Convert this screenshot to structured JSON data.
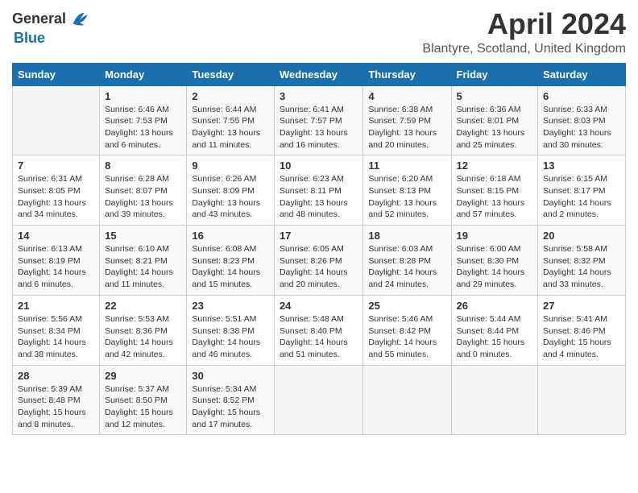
{
  "header": {
    "logo_general": "General",
    "logo_blue": "Blue",
    "month_year": "April 2024",
    "location": "Blantyre, Scotland, United Kingdom"
  },
  "days_of_week": [
    "Sunday",
    "Monday",
    "Tuesday",
    "Wednesday",
    "Thursday",
    "Friday",
    "Saturday"
  ],
  "weeks": [
    [
      {
        "day": "",
        "sunrise": "",
        "sunset": "",
        "daylight": ""
      },
      {
        "day": "1",
        "sunrise": "Sunrise: 6:46 AM",
        "sunset": "Sunset: 7:53 PM",
        "daylight": "Daylight: 13 hours and 6 minutes."
      },
      {
        "day": "2",
        "sunrise": "Sunrise: 6:44 AM",
        "sunset": "Sunset: 7:55 PM",
        "daylight": "Daylight: 13 hours and 11 minutes."
      },
      {
        "day": "3",
        "sunrise": "Sunrise: 6:41 AM",
        "sunset": "Sunset: 7:57 PM",
        "daylight": "Daylight: 13 hours and 16 minutes."
      },
      {
        "day": "4",
        "sunrise": "Sunrise: 6:38 AM",
        "sunset": "Sunset: 7:59 PM",
        "daylight": "Daylight: 13 hours and 20 minutes."
      },
      {
        "day": "5",
        "sunrise": "Sunrise: 6:36 AM",
        "sunset": "Sunset: 8:01 PM",
        "daylight": "Daylight: 13 hours and 25 minutes."
      },
      {
        "day": "6",
        "sunrise": "Sunrise: 6:33 AM",
        "sunset": "Sunset: 8:03 PM",
        "daylight": "Daylight: 13 hours and 30 minutes."
      }
    ],
    [
      {
        "day": "7",
        "sunrise": "Sunrise: 6:31 AM",
        "sunset": "Sunset: 8:05 PM",
        "daylight": "Daylight: 13 hours and 34 minutes."
      },
      {
        "day": "8",
        "sunrise": "Sunrise: 6:28 AM",
        "sunset": "Sunset: 8:07 PM",
        "daylight": "Daylight: 13 hours and 39 minutes."
      },
      {
        "day": "9",
        "sunrise": "Sunrise: 6:26 AM",
        "sunset": "Sunset: 8:09 PM",
        "daylight": "Daylight: 13 hours and 43 minutes."
      },
      {
        "day": "10",
        "sunrise": "Sunrise: 6:23 AM",
        "sunset": "Sunset: 8:11 PM",
        "daylight": "Daylight: 13 hours and 48 minutes."
      },
      {
        "day": "11",
        "sunrise": "Sunrise: 6:20 AM",
        "sunset": "Sunset: 8:13 PM",
        "daylight": "Daylight: 13 hours and 52 minutes."
      },
      {
        "day": "12",
        "sunrise": "Sunrise: 6:18 AM",
        "sunset": "Sunset: 8:15 PM",
        "daylight": "Daylight: 13 hours and 57 minutes."
      },
      {
        "day": "13",
        "sunrise": "Sunrise: 6:15 AM",
        "sunset": "Sunset: 8:17 PM",
        "daylight": "Daylight: 14 hours and 2 minutes."
      }
    ],
    [
      {
        "day": "14",
        "sunrise": "Sunrise: 6:13 AM",
        "sunset": "Sunset: 8:19 PM",
        "daylight": "Daylight: 14 hours and 6 minutes."
      },
      {
        "day": "15",
        "sunrise": "Sunrise: 6:10 AM",
        "sunset": "Sunset: 8:21 PM",
        "daylight": "Daylight: 14 hours and 11 minutes."
      },
      {
        "day": "16",
        "sunrise": "Sunrise: 6:08 AM",
        "sunset": "Sunset: 8:23 PM",
        "daylight": "Daylight: 14 hours and 15 minutes."
      },
      {
        "day": "17",
        "sunrise": "Sunrise: 6:05 AM",
        "sunset": "Sunset: 8:26 PM",
        "daylight": "Daylight: 14 hours and 20 minutes."
      },
      {
        "day": "18",
        "sunrise": "Sunrise: 6:03 AM",
        "sunset": "Sunset: 8:28 PM",
        "daylight": "Daylight: 14 hours and 24 minutes."
      },
      {
        "day": "19",
        "sunrise": "Sunrise: 6:00 AM",
        "sunset": "Sunset: 8:30 PM",
        "daylight": "Daylight: 14 hours and 29 minutes."
      },
      {
        "day": "20",
        "sunrise": "Sunrise: 5:58 AM",
        "sunset": "Sunset: 8:32 PM",
        "daylight": "Daylight: 14 hours and 33 minutes."
      }
    ],
    [
      {
        "day": "21",
        "sunrise": "Sunrise: 5:56 AM",
        "sunset": "Sunset: 8:34 PM",
        "daylight": "Daylight: 14 hours and 38 minutes."
      },
      {
        "day": "22",
        "sunrise": "Sunrise: 5:53 AM",
        "sunset": "Sunset: 8:36 PM",
        "daylight": "Daylight: 14 hours and 42 minutes."
      },
      {
        "day": "23",
        "sunrise": "Sunrise: 5:51 AM",
        "sunset": "Sunset: 8:38 PM",
        "daylight": "Daylight: 14 hours and 46 minutes."
      },
      {
        "day": "24",
        "sunrise": "Sunrise: 5:48 AM",
        "sunset": "Sunset: 8:40 PM",
        "daylight": "Daylight: 14 hours and 51 minutes."
      },
      {
        "day": "25",
        "sunrise": "Sunrise: 5:46 AM",
        "sunset": "Sunset: 8:42 PM",
        "daylight": "Daylight: 14 hours and 55 minutes."
      },
      {
        "day": "26",
        "sunrise": "Sunrise: 5:44 AM",
        "sunset": "Sunset: 8:44 PM",
        "daylight": "Daylight: 15 hours and 0 minutes."
      },
      {
        "day": "27",
        "sunrise": "Sunrise: 5:41 AM",
        "sunset": "Sunset: 8:46 PM",
        "daylight": "Daylight: 15 hours and 4 minutes."
      }
    ],
    [
      {
        "day": "28",
        "sunrise": "Sunrise: 5:39 AM",
        "sunset": "Sunset: 8:48 PM",
        "daylight": "Daylight: 15 hours and 8 minutes."
      },
      {
        "day": "29",
        "sunrise": "Sunrise: 5:37 AM",
        "sunset": "Sunset: 8:50 PM",
        "daylight": "Daylight: 15 hours and 12 minutes."
      },
      {
        "day": "30",
        "sunrise": "Sunrise: 5:34 AM",
        "sunset": "Sunset: 8:52 PM",
        "daylight": "Daylight: 15 hours and 17 minutes."
      },
      {
        "day": "",
        "sunrise": "",
        "sunset": "",
        "daylight": ""
      },
      {
        "day": "",
        "sunrise": "",
        "sunset": "",
        "daylight": ""
      },
      {
        "day": "",
        "sunrise": "",
        "sunset": "",
        "daylight": ""
      },
      {
        "day": "",
        "sunrise": "",
        "sunset": "",
        "daylight": ""
      }
    ]
  ]
}
